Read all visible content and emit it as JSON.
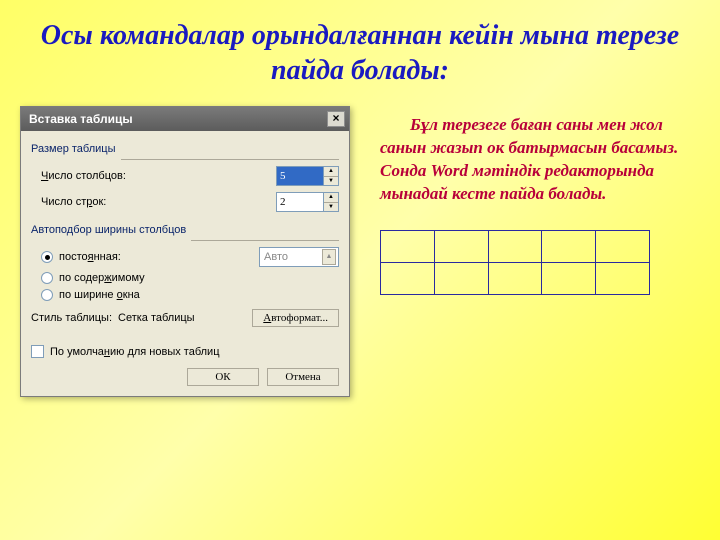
{
  "slide": {
    "title": "Осы командалар орындалғаннан кейін мына терезе пайда болады:",
    "body_text": "Бұл терезеге баған саны мен жол санын жазып ок батырмасын басамыз. Сонда Word мәтіндік  редакторында мынадай кесте пайда болады."
  },
  "dialog": {
    "title": "Вставка таблицы",
    "close": "×",
    "size_group": "Размер таблицы",
    "cols_label": "Число столбцов:",
    "cols_value": "5",
    "rows_label": "Число строк:",
    "rows_value": "2",
    "autofit_group": "Автоподбор ширины столбцов",
    "fixed_label": "постоянная:",
    "fixed_value": "Авто",
    "bycontent_label": "по содержимому",
    "bywindow_label": "по ширине окна",
    "style_label": "Стиль таблицы:",
    "style_value": "Сетка таблицы",
    "autoformat": "Автоформат...",
    "default_check": "По умолчанию для новых таблиц",
    "ok": "ОК",
    "cancel": "Отмена",
    "up": "▲",
    "down": "▼"
  },
  "sample_table": {
    "rows": 2,
    "cols": 5
  }
}
